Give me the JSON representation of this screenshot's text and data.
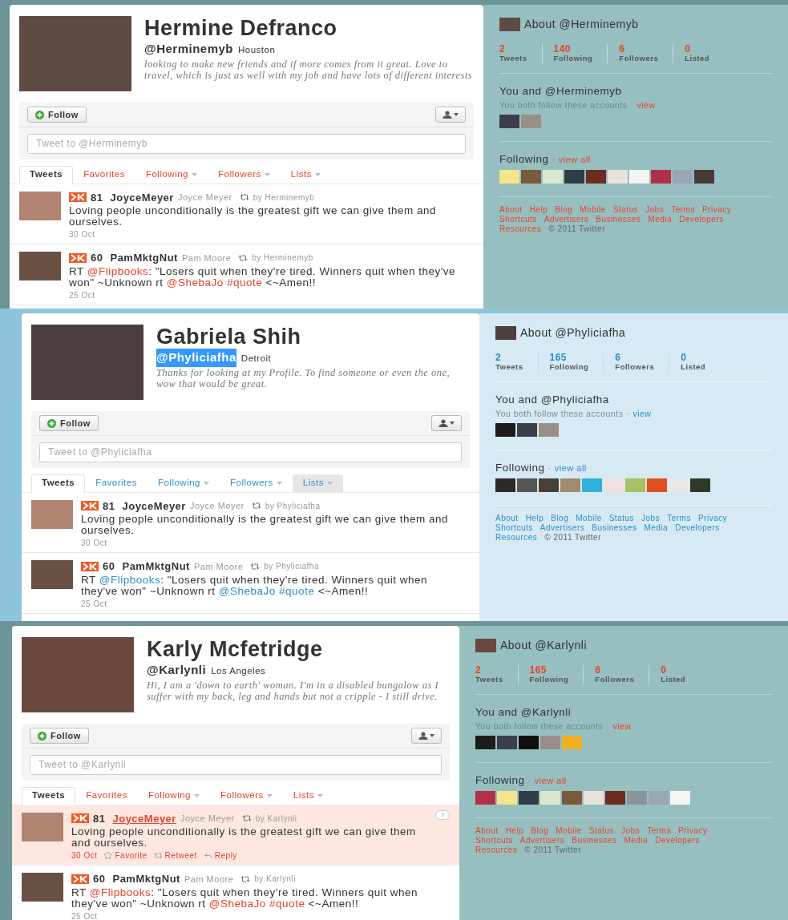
{
  "profiles": [
    {
      "kind": "teal",
      "name": "Hermine Defranco",
      "handle": "@Herminemyb",
      "handle_selected": false,
      "location": "Houston",
      "bio": "looking to make new friends and if more comes from it great. Love to travel, which is just as well with my job and have lots of different interests",
      "follow_label": "Follow",
      "tweet_placeholder": "Tweet to @Herminemyb",
      "tabs": [
        {
          "label": "Tweets",
          "selected": true,
          "dropdown": false,
          "hovered": false
        },
        {
          "label": "Favorites",
          "selected": false,
          "dropdown": false,
          "hovered": false
        },
        {
          "label": "Following",
          "selected": false,
          "dropdown": true,
          "hovered": false
        },
        {
          "label": "Followers",
          "selected": false,
          "dropdown": true,
          "hovered": false
        },
        {
          "label": "Lists",
          "selected": false,
          "dropdown": true,
          "hovered": false
        }
      ],
      "tweets": [
        {
          "score": "81",
          "username": "JoyceMeyer",
          "full_name": "Joyce Meyer",
          "retweeted_by": "by Herminemyb",
          "text": [
            {
              "kind": "plain",
              "text": "Loving people unconditionally is the greatest gift we can give them and ourselves."
            }
          ],
          "date": "30 Oct",
          "highlighted": false
        },
        {
          "score": "60",
          "username": "PamMktgNut",
          "full_name": "Pam Moore",
          "retweeted_by": "by Herminemyb",
          "text": [
            {
              "kind": "plain",
              "text": "RT "
            },
            {
              "kind": "link",
              "text": "@Flipbooks"
            },
            {
              "kind": "plain",
              "text": ": \"Losers quit when they're tired. Winners quit when they've won\" ~Unknown rt "
            },
            {
              "kind": "link",
              "text": "@ShebaJo"
            },
            {
              "kind": "link",
              "text": "#quote"
            },
            {
              "kind": "plain",
              "text": " <~Amen!!"
            }
          ],
          "date": "25 Oct",
          "highlighted": false
        }
      ],
      "sidebar": {
        "about_title": "About @Herminemyb",
        "separator": "·",
        "stats": [
          {
            "value": "2",
            "label": "Tweets"
          },
          {
            "value": "140",
            "label": "Following"
          },
          {
            "value": "6",
            "label": "Followers"
          },
          {
            "value": "0",
            "label": "Listed"
          }
        ],
        "you_and_title": "You and @Herminemyb",
        "both_follow": "You both follow these accounts",
        "view": "view",
        "shared": [
          {
            "color": "#3a3f4a"
          },
          {
            "color": "#9a8f88"
          }
        ],
        "following_title": "Following",
        "view_all": "view all",
        "following": [
          {
            "color": "#f3e58a"
          },
          {
            "color": "#7a5a3c"
          },
          {
            "color": "#d8e8d0"
          },
          {
            "color": "#2f3d44"
          },
          {
            "color": "#6b2e20"
          },
          {
            "color": "#e8e2dc"
          },
          {
            "color": "#f4f4f4"
          },
          {
            "color": "#b0304a"
          },
          {
            "color": "#9aa6b4"
          },
          {
            "color": "#4a3a36"
          }
        ],
        "footer_links": [
          "About",
          "Help",
          "Blog",
          "Mobile",
          "Status",
          "Jobs",
          "Terms",
          "Privacy",
          "Shortcuts",
          "Advertisers",
          "Businesses",
          "Media",
          "Developers",
          "Resources"
        ],
        "copyright": "© 2011 Twitter"
      }
    },
    {
      "kind": "blue",
      "name": "Gabriela Shih",
      "handle": "@Phyliciafha",
      "handle_selected": true,
      "location": "Detroit",
      "bio": "Thanks for looking at my Profile. To find someone or even the one, wow that would be great.",
      "follow_label": "Follow",
      "tweet_placeholder": "Tweet to @Phyliciafha",
      "tabs": [
        {
          "label": "Tweets",
          "selected": true,
          "dropdown": false,
          "hovered": false
        },
        {
          "label": "Favorites",
          "selected": false,
          "dropdown": false,
          "hovered": false
        },
        {
          "label": "Following",
          "selected": false,
          "dropdown": true,
          "hovered": false
        },
        {
          "label": "Followers",
          "selected": false,
          "dropdown": true,
          "hovered": false
        },
        {
          "label": "Lists",
          "selected": false,
          "dropdown": true,
          "hovered": true
        }
      ],
      "tweets": [
        {
          "score": "81",
          "username": "JoyceMeyer",
          "full_name": "Joyce Meyer",
          "retweeted_by": "by Phyliciafha",
          "text": [
            {
              "kind": "plain",
              "text": "Loving people unconditionally is the greatest gift we can give them and ourselves."
            }
          ],
          "date": "30 Oct",
          "highlighted": false
        },
        {
          "score": "60",
          "username": "PamMktgNut",
          "full_name": "Pam Moore",
          "retweeted_by": "by Phyliciafha",
          "text": [
            {
              "kind": "plain",
              "text": "RT "
            },
            {
              "kind": "link",
              "text": "@Flipbooks"
            },
            {
              "kind": "plain",
              "text": ": \"Losers quit when they're tired. Winners quit when they've won\" ~Unknown rt "
            },
            {
              "kind": "link",
              "text": "@ShebaJo"
            },
            {
              "kind": "link",
              "text": "#quote"
            },
            {
              "kind": "plain",
              "text": " <~Amen!!"
            }
          ],
          "date": "25 Oct",
          "highlighted": false
        }
      ],
      "sidebar": {
        "about_title": "About @Phyliciafha",
        "separator": "·",
        "stats": [
          {
            "value": "2",
            "label": "Tweets"
          },
          {
            "value": "165",
            "label": "Following"
          },
          {
            "value": "6",
            "label": "Followers"
          },
          {
            "value": "0",
            "label": "Listed"
          }
        ],
        "you_and_title": "You and @Phyliciafha",
        "both_follow": "You both follow these accounts",
        "view": "view",
        "shared": [
          {
            "color": "#1c1c1c"
          },
          {
            "color": "#3a3f4a"
          },
          {
            "color": "#9a8f88"
          }
        ],
        "following_title": "Following",
        "view_all": "view all",
        "following": [
          {
            "color": "#2a2a2a"
          },
          {
            "color": "#555555"
          },
          {
            "color": "#4a4038"
          },
          {
            "color": "#a08a70"
          },
          {
            "color": "#2fb0d8"
          },
          {
            "color": "#f0e0e0"
          },
          {
            "color": "#a8c060"
          },
          {
            "color": "#e05020"
          },
          {
            "color": "#e8e8e8"
          },
          {
            "color": "#303828"
          }
        ],
        "footer_links": [
          "About",
          "Help",
          "Blog",
          "Mobile",
          "Status",
          "Jobs",
          "Terms",
          "Privacy",
          "Shortcuts",
          "Advertisers",
          "Businesses",
          "Media",
          "Developers",
          "Resources"
        ],
        "copyright": "© 2011 Twitter"
      }
    },
    {
      "kind": "teal",
      "name": "Karly Mcfetridge",
      "handle": "@Karlynli",
      "handle_selected": false,
      "location": "Los Angeles",
      "bio": "Hi, I am a 'down to earth' woman. I'm in a disabled bungalow as I suffer with my back, leg and hands but not a cripple - I still drive.",
      "follow_label": "Follow",
      "tweet_placeholder": "Tweet to @Karlynli",
      "tabs": [
        {
          "label": "Tweets",
          "selected": true,
          "dropdown": false,
          "hovered": false
        },
        {
          "label": "Favorites",
          "selected": false,
          "dropdown": false,
          "hovered": false
        },
        {
          "label": "Following",
          "selected": false,
          "dropdown": true,
          "hovered": false
        },
        {
          "label": "Followers",
          "selected": false,
          "dropdown": true,
          "hovered": false
        },
        {
          "label": "Lists",
          "selected": false,
          "dropdown": true,
          "hovered": false
        }
      ],
      "tweets": [
        {
          "score": "81",
          "username": "JoyceMeyer",
          "full_name": "Joyce Meyer",
          "retweeted_by": "by Karlynli",
          "text": [
            {
              "kind": "plain",
              "text": "Loving people unconditionally is the greatest gift we can give them and ourselves."
            }
          ],
          "date": "30 Oct",
          "highlighted": true,
          "actions": [
            {
              "kind": "favorite",
              "label": "Favorite"
            },
            {
              "kind": "retweet",
              "label": "Retweet"
            },
            {
              "kind": "reply",
              "label": "Reply"
            }
          ]
        },
        {
          "score": "60",
          "username": "PamMktgNut",
          "full_name": "Pam Moore",
          "retweeted_by": "by Karlynli",
          "text": [
            {
              "kind": "plain",
              "text": "RT "
            },
            {
              "kind": "link",
              "text": "@Flipbooks"
            },
            {
              "kind": "plain",
              "text": ": \"Losers quit when they're tired. Winners quit when they've won\" ~Unknown rt "
            },
            {
              "kind": "link",
              "text": "@ShebaJo"
            },
            {
              "kind": "link",
              "text": "#quote"
            },
            {
              "kind": "plain",
              "text": " <~Amen!!"
            }
          ],
          "date": "25 Oct",
          "highlighted": false
        }
      ],
      "sidebar": {
        "about_title": "About @Karlynli",
        "separator": "·",
        "stats": [
          {
            "value": "2",
            "label": "Tweets"
          },
          {
            "value": "165",
            "label": "Following"
          },
          {
            "value": "6",
            "label": "Followers"
          },
          {
            "value": "0",
            "label": "Listed"
          }
        ],
        "you_and_title": "You and @Karlynli",
        "both_follow": "You both follow these accounts",
        "view": "view",
        "shared": [
          {
            "color": "#1c1c1c"
          },
          {
            "color": "#3a3f4a"
          },
          {
            "color": "#101010"
          },
          {
            "color": "#9a8f88"
          },
          {
            "color": "#f0b020"
          }
        ],
        "following_title": "Following",
        "view_all": "view all",
        "following": [
          {
            "color": "#b0304a"
          },
          {
            "color": "#f3e58a"
          },
          {
            "color": "#2f3d44"
          },
          {
            "color": "#d8e8d0"
          },
          {
            "color": "#7a5a3c"
          },
          {
            "color": "#e8e2dc"
          },
          {
            "color": "#6b2e20"
          },
          {
            "color": "#8a949c"
          },
          {
            "color": "#9aa6b4"
          },
          {
            "color": "#f4f4f4"
          }
        ],
        "footer_links": [
          "About",
          "Help",
          "Blog",
          "Mobile",
          "Status",
          "Jobs",
          "Terms",
          "Privacy",
          "Shortcuts",
          "Advertisers",
          "Businesses",
          "Media",
          "Developers",
          "Resources"
        ],
        "copyright": "© 2011 Twitter"
      }
    }
  ]
}
